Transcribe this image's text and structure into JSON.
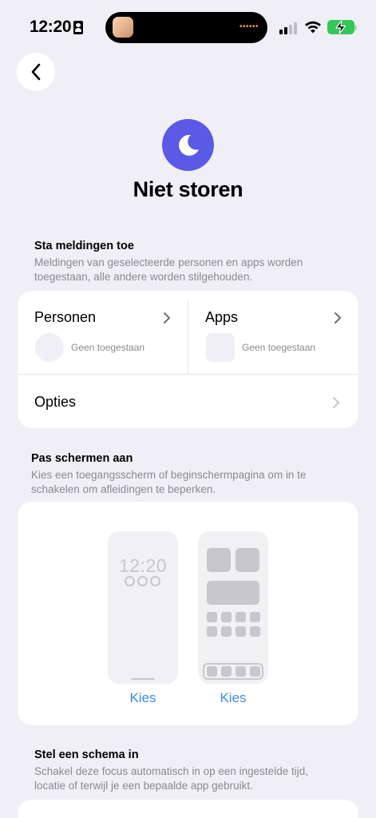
{
  "status_bar": {
    "time": "12:20",
    "island_dots": "••••••"
  },
  "header": {
    "title": "Niet storen"
  },
  "notifications": {
    "title": "Sta meldingen toe",
    "subtitle_line1": "Meldingen van geselecteerde personen en apps worden",
    "subtitle_line2": "toegestaan, alle andere worden stilgehouden.",
    "people_label": "Personen",
    "people_status": "Geen toegestaan",
    "apps_label": "Apps",
    "apps_status": "Geen toegestaan",
    "options_label": "Opties"
  },
  "screens": {
    "title": "Pas schermen aan",
    "subtitle_line1": "Kies een toegangsscherm of beginschermpagina om in te",
    "subtitle_line2": "schakelen om afleidingen te beperken.",
    "lock_time": "12:20",
    "choose_lock": "Kies",
    "choose_home": "Kies"
  },
  "schedule": {
    "title": "Stel een schema in",
    "subtitle_line1": "Schakel deze focus automatisch in op een ingestelde tijd,",
    "subtitle_line2": "locatie of terwijl je een bepaalde app gebruikt."
  },
  "colors": {
    "accent": "#5b5ae6",
    "link": "#3b8cf0",
    "background": "#f0eff5",
    "battery": "#34c759"
  },
  "icons": [
    "id-card-icon",
    "signal-icon",
    "wifi-icon",
    "battery-charging-icon",
    "back-chevron-icon",
    "moon-icon",
    "chevron-right-icon"
  ]
}
